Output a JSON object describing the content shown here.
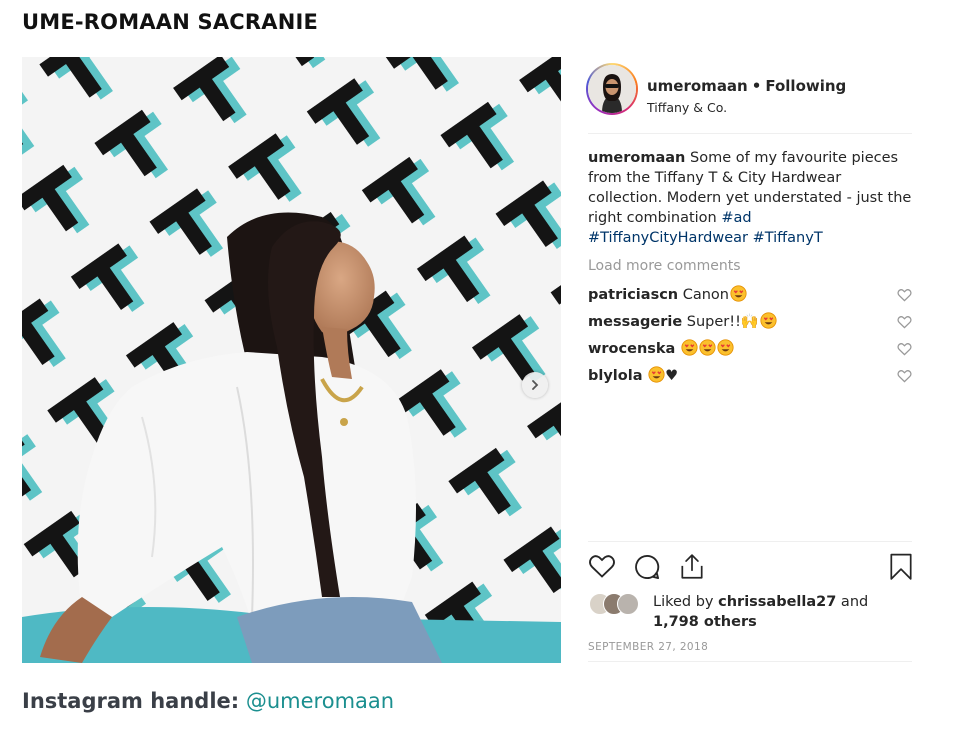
{
  "page": {
    "heading": "UME-ROMAAN SACRANIE",
    "handle_label": "Instagram handle:",
    "handle_value": "@umeromaan"
  },
  "post": {
    "username": "umeromaan",
    "separator": "•",
    "follow_status": "Following",
    "location": "Tiffany & Co.",
    "caption": {
      "username": "umeromaan",
      "text": " Some of my favourite pieces from the Tiffany T & City Hardwear collection. Modern yet understated - just the right combination ",
      "tags": [
        "#ad",
        "#TiffanyCityHardwear",
        "#TiffanyT"
      ]
    },
    "load_more": "Load more comments",
    "comments": [
      {
        "user": "patriciascn",
        "text": " Canon",
        "emoji": [
          "heart-eyes"
        ]
      },
      {
        "user": "messagerie",
        "text": " Super!!🙌",
        "emoji": [
          "heart-eyes"
        ]
      },
      {
        "user": "wrocenska",
        "text": " ",
        "emoji": [
          "heart-eyes",
          "heart-eyes",
          "heart-eyes"
        ]
      },
      {
        "user": "blylola",
        "text": " ",
        "emoji": [
          "heart-eyes"
        ],
        "suffix": "♥"
      }
    ],
    "likes": {
      "prefix": "Liked by ",
      "user": "chrissabella27",
      "middle": " and",
      "count": "1,798 others"
    },
    "date": "SEPTEMBER 27, 2018"
  },
  "colors": {
    "teal": "#5ec4c6",
    "link": "#003569",
    "muted": "#999999",
    "handle": "#1b8f8f"
  },
  "icons": [
    "heart-icon",
    "comment-icon",
    "share-icon",
    "bookmark-icon",
    "chevron-right-icon"
  ]
}
